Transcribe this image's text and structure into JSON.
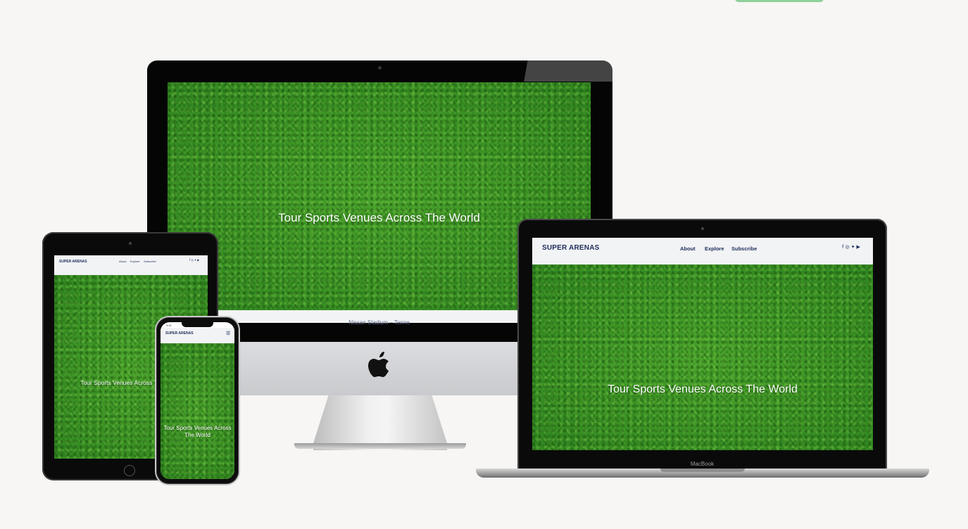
{
  "top_badge": {
    "color": "#8fd19a"
  },
  "brand": "SUPER ARENAS",
  "hero_title": "Tour Sports Venues Across The World",
  "nav": {
    "about": "About",
    "explore": "Explore",
    "subscribe": "Subscribe"
  },
  "social_icons": [
    "facebook-icon",
    "instagram-icon",
    "twitter-icon",
    "youtube-icon"
  ],
  "social_glyphs": {
    "facebook": "f",
    "instagram": "◎",
    "twitter": "✦",
    "youtube": "▶"
  },
  "imac": {
    "caption": "Nissan Stadium – Tenne"
  },
  "macbook": {
    "label": "MacBook"
  },
  "phone": {
    "status_time": "9:41",
    "menu_glyph": "☰"
  },
  "devices": [
    "imac",
    "macbook",
    "ipad",
    "iphone"
  ]
}
